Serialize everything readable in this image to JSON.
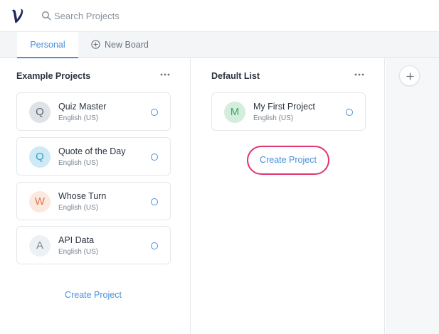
{
  "header": {
    "logo_icon": "v-logo-icon",
    "search": {
      "placeholder": "Search Projects",
      "value": ""
    }
  },
  "tabs": {
    "personal_label": "Personal",
    "new_board_label": "New Board"
  },
  "columns": [
    {
      "title": "Example Projects",
      "projects": [
        {
          "initial": "Q",
          "name": "Quiz Master",
          "language": "English (US)",
          "avatar_bg": "#dfe3e8",
          "avatar_fg": "#5c6670"
        },
        {
          "initial": "Q",
          "name": "Quote of the Day",
          "language": "English (US)",
          "avatar_bg": "#cdeaf5",
          "avatar_fg": "#3aa0c8"
        },
        {
          "initial": "W",
          "name": "Whose Turn",
          "language": "English (US)",
          "avatar_bg": "#fbe9df",
          "avatar_fg": "#d9794a"
        },
        {
          "initial": "A",
          "name": "API Data",
          "language": "English (US)",
          "avatar_bg": "#eef1f4",
          "avatar_fg": "#7d8893"
        }
      ],
      "create_label": "Create Project"
    },
    {
      "title": "Default List",
      "projects": [
        {
          "initial": "M",
          "name": "My First Project",
          "language": "English (US)",
          "avatar_bg": "#d3eedd",
          "avatar_fg": "#45a36c"
        }
      ],
      "create_label": "Create Project"
    }
  ],
  "colors": {
    "accent": "#4a90d9",
    "highlight": "#e0356f"
  }
}
